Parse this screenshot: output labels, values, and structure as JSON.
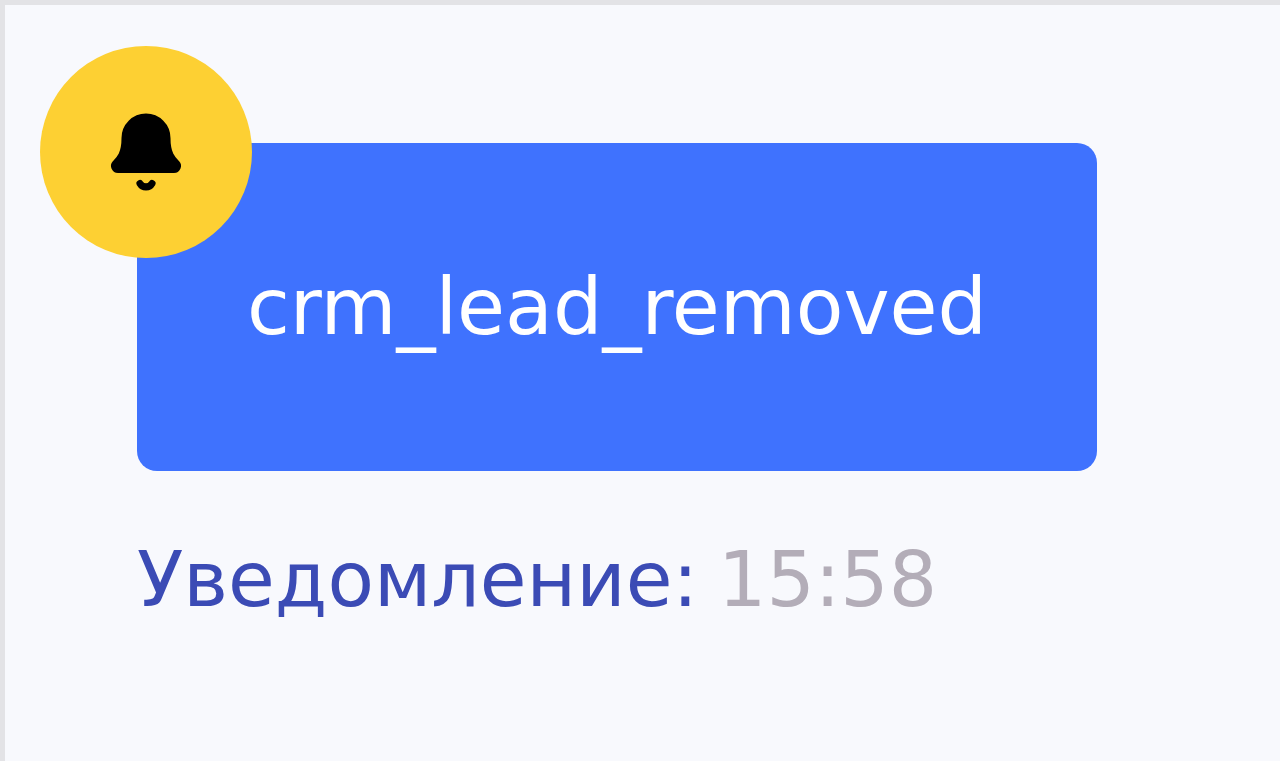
{
  "notification": {
    "event": "crm_lead_removed",
    "label": "Уведомление:",
    "time": "15:58"
  }
}
